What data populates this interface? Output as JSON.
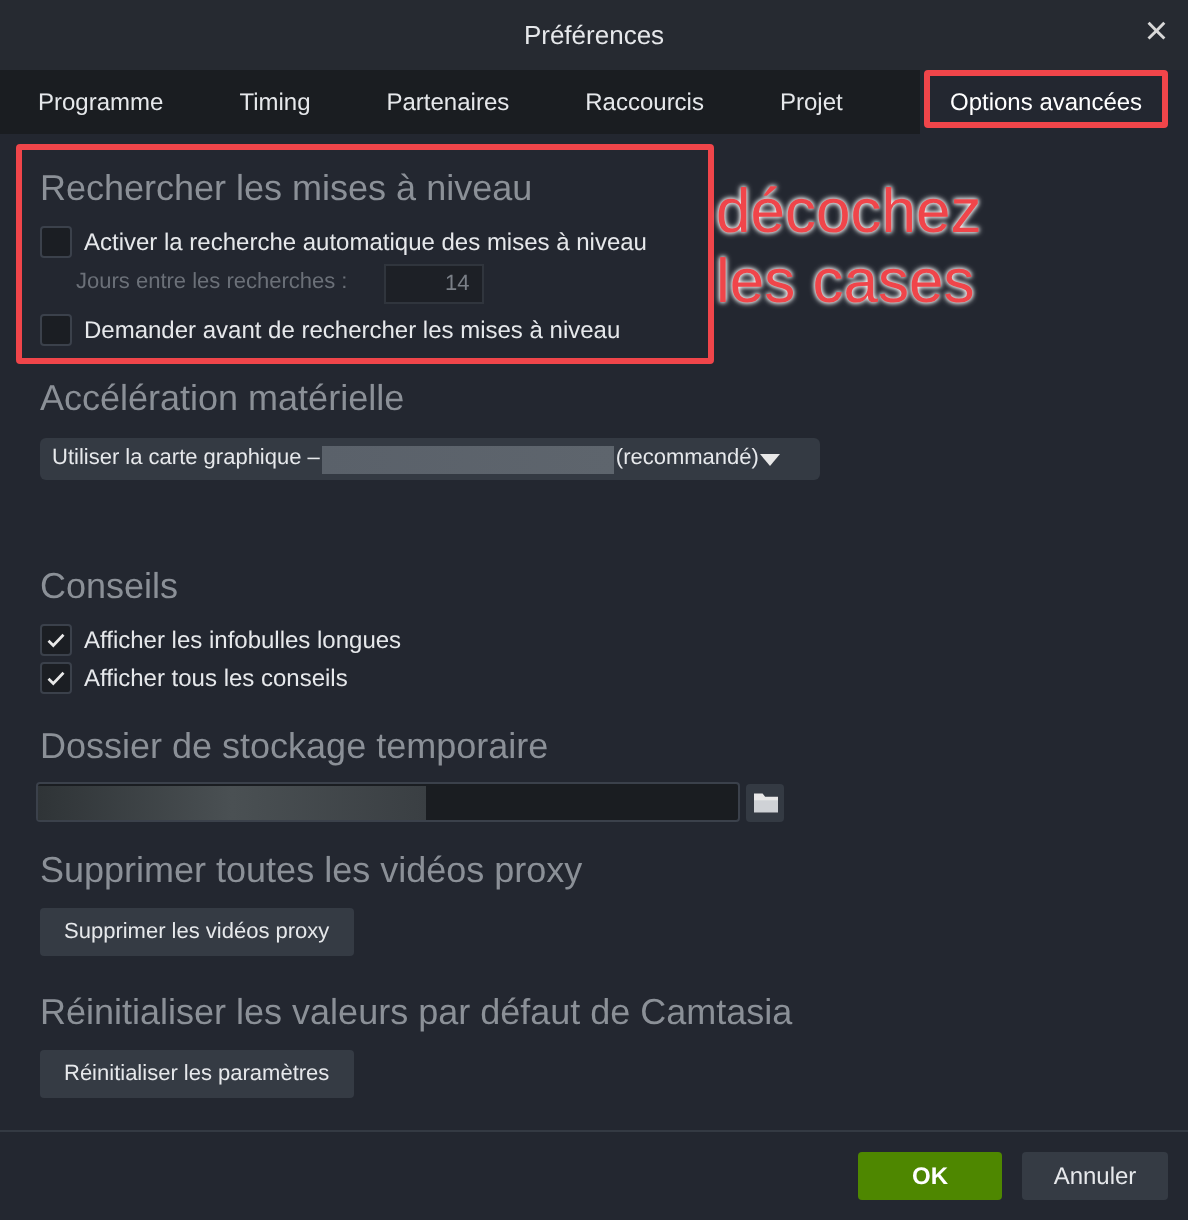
{
  "window": {
    "title": "Préférences",
    "close": "×"
  },
  "tabs": [
    {
      "label": "Programme",
      "selected": false
    },
    {
      "label": "Timing",
      "selected": false
    },
    {
      "label": "Partenaires",
      "selected": false
    },
    {
      "label": "Raccourcis",
      "selected": false
    },
    {
      "label": "Projet",
      "selected": false
    },
    {
      "label": "Options avancées",
      "selected": true
    }
  ],
  "updates": {
    "heading": "Rechercher les mises à niveau",
    "auto_check": {
      "label": "Activer la recherche automatique des mises à niveau",
      "checked": false
    },
    "days": {
      "label": "Jours entre les recherches :",
      "value": "14",
      "disabled": true
    },
    "ask_before": {
      "label": "Demander avant de rechercher les mises à niveau",
      "checked": false
    }
  },
  "acceleration": {
    "heading": "Accélération matérielle",
    "dropdown_prefix": "Utiliser la carte graphique –",
    "dropdown_suffix": "(recommandé)"
  },
  "tips": {
    "heading": "Conseils",
    "options": [
      {
        "label": "Afficher les infobulles longues",
        "checked": true
      },
      {
        "label": "Afficher tous les conseils",
        "checked": true
      }
    ]
  },
  "temp_folder": {
    "heading": "Dossier de stockage temporaire"
  },
  "proxy": {
    "heading": "Supprimer toutes les vidéos proxy",
    "button": "Supprimer les vidéos proxy"
  },
  "reset": {
    "heading": "Réinitialiser les valeurs par défaut de Camtasia",
    "button": "Réinitialiser les paramètres"
  },
  "footer": {
    "ok": "OK",
    "cancel": "Annuler"
  },
  "annotation": {
    "text": "décochez les cases"
  }
}
